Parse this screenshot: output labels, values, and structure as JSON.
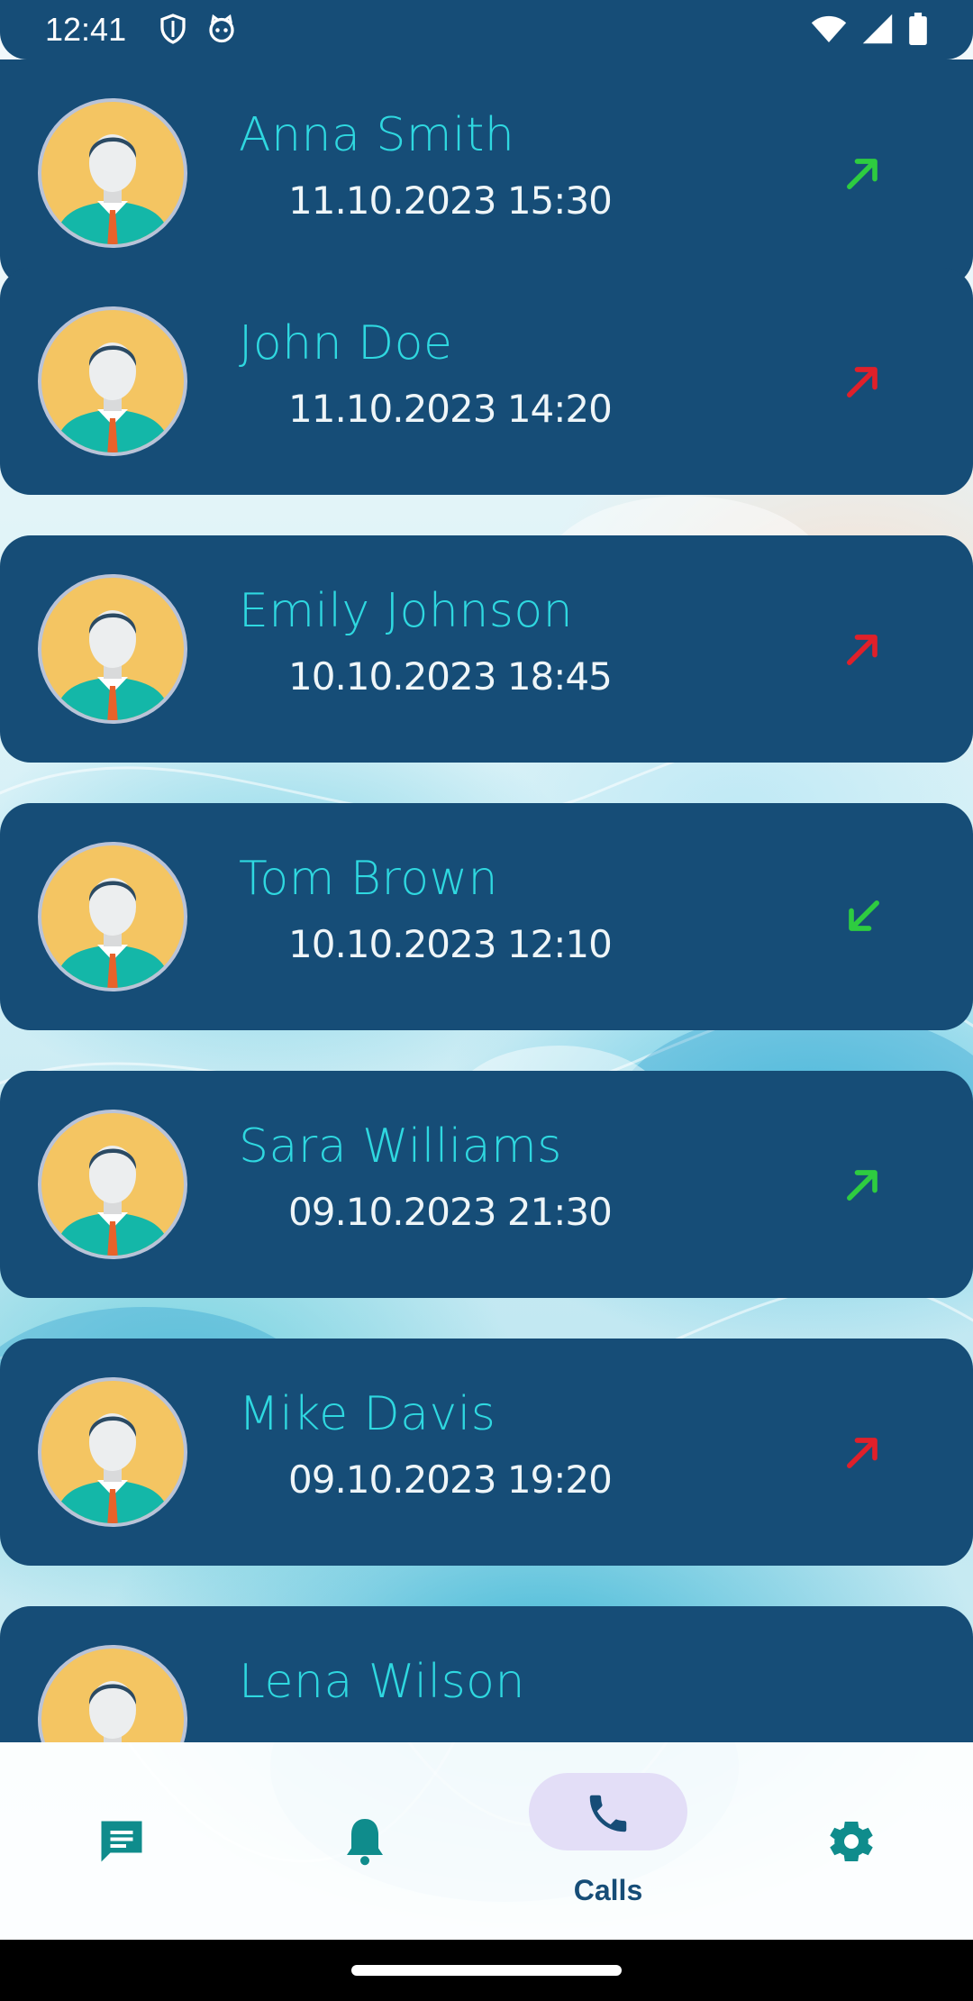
{
  "status_bar": {
    "time": "12:41",
    "left_icons": [
      "shield-icon",
      "cat-icon"
    ],
    "right_icons": [
      "wifi-icon",
      "signal-icon",
      "battery-icon"
    ]
  },
  "calls": [
    {
      "name": "Anna Smith",
      "datetime": "11.10.2023 15:30",
      "direction": "outgoing",
      "color": "#2ecc40"
    },
    {
      "name": "John Doe",
      "datetime": "11.10.2023 14:20",
      "direction": "outgoing",
      "color": "#e0202a"
    },
    {
      "name": "Emily Johnson",
      "datetime": "10.10.2023 18:45",
      "direction": "outgoing",
      "color": "#e0202a"
    },
    {
      "name": "Tom Brown",
      "datetime": "10.10.2023 12:10",
      "direction": "incoming",
      "color": "#2ecc40"
    },
    {
      "name": "Sara Williams",
      "datetime": "09.10.2023 21:30",
      "direction": "outgoing",
      "color": "#2ecc40"
    },
    {
      "name": "Mike Davis",
      "datetime": "09.10.2023 19:20",
      "direction": "outgoing",
      "color": "#e0202a"
    },
    {
      "name": "Lena Wilson",
      "datetime": "",
      "direction": "",
      "color": ""
    }
  ],
  "bottom_nav": {
    "items": [
      {
        "icon": "message-icon",
        "label": ""
      },
      {
        "icon": "bell-icon",
        "label": ""
      },
      {
        "icon": "phone-icon",
        "label": "Calls",
        "selected": true
      },
      {
        "icon": "gear-icon",
        "label": ""
      }
    ]
  },
  "colors": {
    "card": "#164d77",
    "name": "#2fd8e0",
    "nav_accent": "#0f8c8c",
    "nav_selected_pill": "#e3def7"
  }
}
